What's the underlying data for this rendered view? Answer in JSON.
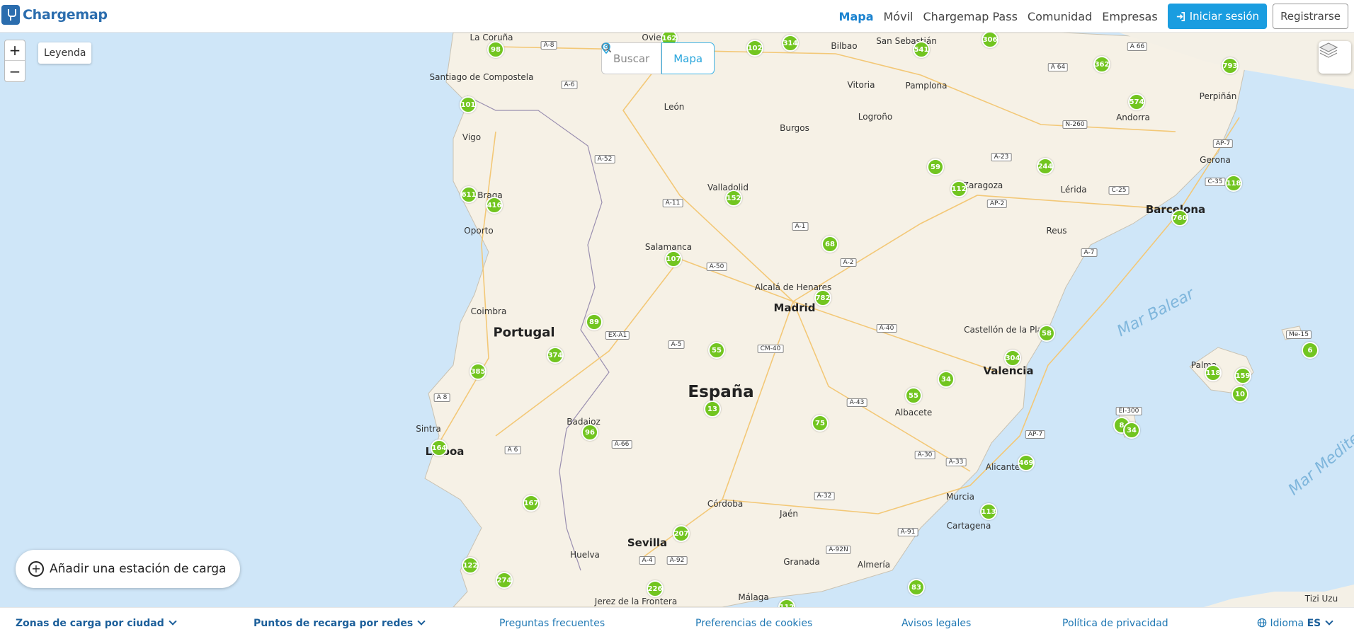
{
  "header": {
    "brand": "Chargemap",
    "nav": [
      "Mapa",
      "Móvil",
      "Chargemap Pass",
      "Comunidad",
      "Empresas"
    ],
    "active_nav": "Mapa",
    "login_label": "Iniciar sesión",
    "register_label": "Registrarse"
  },
  "map_controls": {
    "zoom_in": "+",
    "zoom_out": "−",
    "legend": "Leyenda",
    "search_label": "Buscar",
    "map_label": "Mapa",
    "add_station": "Añadir una estación de carga"
  },
  "colors": {
    "brand": "#2b6dae",
    "accent": "#1a9de0",
    "cluster": "#72c520",
    "sea": "#cfe6f8",
    "land": "#f7f3ea"
  },
  "icons": [
    "search-icon",
    "pin-icon",
    "layers-icon",
    "login-icon",
    "plus-circle-icon",
    "chevron-down-icon",
    "globe-icon"
  ],
  "place_labels": {
    "countries": [
      "España",
      "Portugal"
    ],
    "capital": "Madrid",
    "cities": [
      "La Coruña",
      "Santiago de Compostela",
      "Vigo",
      "Braga",
      "Oporto",
      "Coimbra",
      "Lisboa",
      "Sintra",
      "León",
      "Burgos",
      "Bilbao",
      "San Sebastián",
      "Vitoria",
      "Pamplona",
      "Logroño",
      "Valladolid",
      "Salamanca",
      "Alcalá de Henares",
      "Zaragoza",
      "Lérida",
      "Reus",
      "Barcelona",
      "Gerona",
      "Andorra",
      "Perpiñán",
      "Castellón de la Plana",
      "Valencia",
      "Albacete",
      "Alicante",
      "Murcia",
      "Cartagena",
      "Badajoz",
      "Córdoba",
      "Jaén",
      "Sevilla",
      "Huelva",
      "Granada",
      "Almería",
      "Málaga",
      "Jerez de la Frontera",
      "Palma",
      "Tizi Uzu",
      "Ovie"
    ],
    "seas": [
      "Mar Balear",
      "Mar Medite"
    ],
    "roads": [
      "A-8",
      "A-6",
      "A-52",
      "A-11",
      "A-1",
      "A-2",
      "A-50",
      "A-5",
      "CM-40",
      "A-40",
      "A-43",
      "EX-A1",
      "A-66",
      "A 6",
      "A 8",
      "A-32",
      "A-4",
      "A-92",
      "A-92N",
      "A-91",
      "A-30",
      "A-33",
      "AP-7",
      "A-23",
      "AP-2",
      "C-25",
      "A-7",
      "N-260",
      "A 64",
      "A 66",
      "A 64",
      "Me-15",
      "EI-300",
      "C-35",
      "AP-7"
    ]
  },
  "clusters": [
    "162",
    "98",
    "102",
    "314",
    "541",
    "306",
    "362",
    "793",
    "101",
    "574",
    "611",
    "416",
    "59",
    "244",
    "112",
    "118",
    "152",
    "760",
    "68",
    "107",
    "782",
    "89",
    "58",
    "374",
    "55",
    "304",
    "385",
    "34",
    "118",
    "159",
    "10",
    "13",
    "55",
    "75",
    "96",
    "8",
    "34",
    "164",
    "469",
    "167",
    "207",
    "113",
    "122",
    "274",
    "226",
    "83",
    "112",
    "6"
  ],
  "footer": {
    "zones": "Zonas de carga por ciudad",
    "networks": "Puntos de recarga por redes",
    "faq": "Preguntas frecuentes",
    "cookies": "Preferencias de cookies",
    "legal": "Avisos legales",
    "privacy": "Política de privacidad",
    "language_label": "Idioma",
    "language_value": "ES"
  }
}
